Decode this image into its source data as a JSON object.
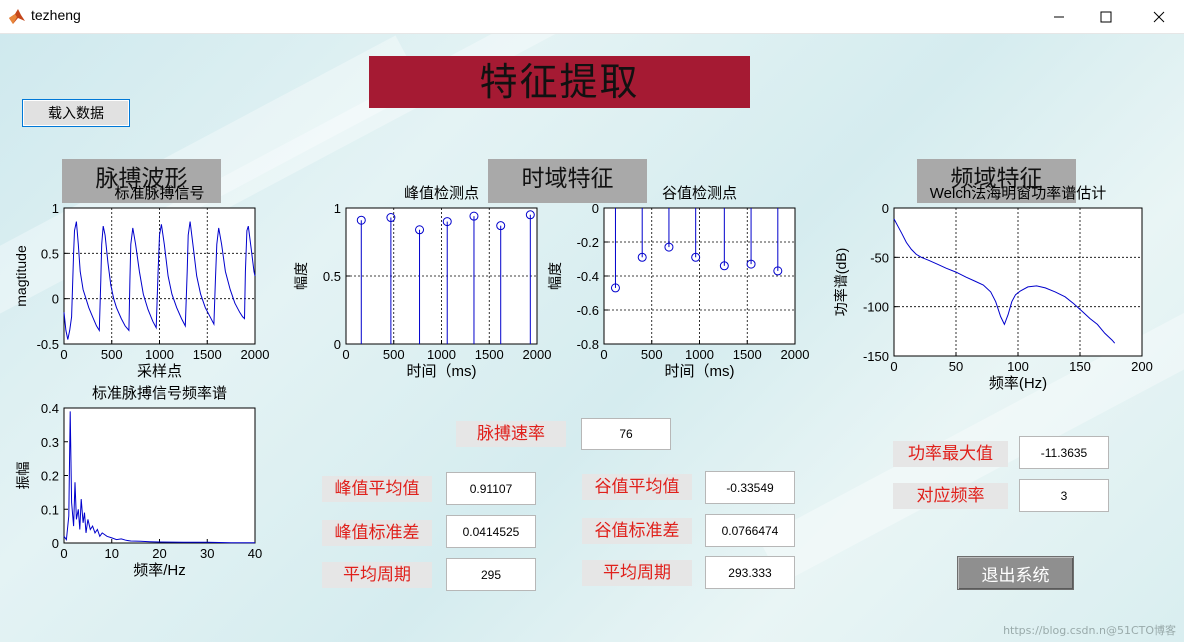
{
  "window": {
    "title": "tezheng",
    "minimize_glyph": "—",
    "maximize_glyph": "☐",
    "close_glyph": "✕",
    "app_icon": "matlab-icon"
  },
  "main_title": "特征提取",
  "load_button": "载入数据",
  "sections": {
    "pulse": "脉搏波形",
    "time": "时域特征",
    "freq": "频域特征"
  },
  "labels": {
    "pulse_rate": "脉搏速率",
    "peak_mean": "峰值平均值",
    "peak_std": "峰值标准差",
    "peak_period": "平均周期",
    "valley_mean": "谷值平均值",
    "valley_std": "谷值标准差",
    "valley_period": "平均周期",
    "power_max": "功率最大值",
    "corr_freq": "对应频率"
  },
  "values": {
    "pulse_rate": "76",
    "peak_mean": "0.91107",
    "peak_std": "0.0414525",
    "peak_period": "295",
    "valley_mean": "-0.33549",
    "valley_std": "0.0766474",
    "valley_period": "293.333",
    "power_max": "-11.3635",
    "corr_freq": "3"
  },
  "exit_button": "退出系统",
  "watermark": "https://blog.csdn.n@51CTO博客",
  "colors": {
    "title_bg": "#a51a33",
    "line": "#0000cc",
    "label_red": "#e0201b"
  },
  "chart_data": [
    {
      "id": "pulse_signal",
      "type": "line",
      "title": "标准脉搏信号",
      "xlabel": "采样点",
      "ylabel": "magtitude",
      "xlim": [
        0,
        2000
      ],
      "ylim": [
        -0.5,
        1
      ],
      "xticks": [
        "0",
        "500",
        "1000",
        "1500",
        "2000"
      ],
      "yticks": [
        "-0.5",
        "0",
        "0.5",
        "1"
      ],
      "grid": true,
      "x": [
        0,
        20,
        40,
        60,
        80,
        100,
        110,
        130,
        150,
        170,
        200,
        230,
        260,
        300,
        340,
        370,
        385,
        395,
        410,
        430,
        460,
        490,
        520,
        550,
        600,
        640,
        680,
        690,
        700,
        720,
        750,
        790,
        830,
        880,
        930,
        965,
        985,
        1000,
        1020,
        1050,
        1090,
        1130,
        1180,
        1230,
        1270,
        1290,
        1300,
        1320,
        1350,
        1390,
        1430,
        1480,
        1530,
        1570,
        1585,
        1600,
        1620,
        1650,
        1690,
        1740,
        1790,
        1840,
        1870,
        1890,
        1900,
        1915,
        1930,
        1960,
        1990,
        2000
      ],
      "y": [
        -0.15,
        -0.35,
        -0.45,
        -0.35,
        -0.2,
        0.5,
        0.75,
        0.85,
        0.6,
        0.3,
        0.1,
        0.0,
        -0.1,
        -0.2,
        -0.3,
        -0.35,
        0.2,
        0.6,
        0.8,
        0.7,
        0.4,
        0.15,
        0.0,
        -0.1,
        -0.22,
        -0.3,
        -0.35,
        0.2,
        0.6,
        0.78,
        0.6,
        0.3,
        0.05,
        -0.12,
        -0.25,
        -0.32,
        0.3,
        0.7,
        0.82,
        0.6,
        0.25,
        0.05,
        -0.1,
        -0.22,
        -0.3,
        0.3,
        0.7,
        0.85,
        0.6,
        0.25,
        0.05,
        -0.1,
        -0.2,
        -0.28,
        0.2,
        0.6,
        0.78,
        0.6,
        0.3,
        0.1,
        -0.05,
        -0.15,
        -0.2,
        -0.22,
        0.3,
        0.75,
        0.8,
        0.55,
        0.3,
        0.25
      ]
    },
    {
      "id": "pulse_spectrum",
      "type": "line",
      "title": "标准脉搏信号频率谱",
      "xlabel": "频率/Hz",
      "ylabel": "振幅",
      "xlim": [
        0,
        40
      ],
      "ylim": [
        0,
        0.4
      ],
      "xticks": [
        "0",
        "10",
        "20",
        "30",
        "40"
      ],
      "yticks": [
        "0",
        "0.1",
        "0.2",
        "0.3",
        "0.4"
      ],
      "grid": false,
      "x": [
        0,
        0.5,
        1,
        1.3,
        1.6,
        2,
        2.3,
        2.6,
        3,
        3.3,
        3.6,
        4,
        4.3,
        4.6,
        5,
        5.5,
        6,
        6.5,
        7,
        7.5,
        8,
        9,
        10,
        11,
        12,
        13,
        14,
        16,
        18,
        20,
        25,
        30,
        35,
        40
      ],
      "y": [
        0.02,
        0.01,
        0.08,
        0.39,
        0.12,
        0.05,
        0.18,
        0.07,
        0.1,
        0.04,
        0.13,
        0.06,
        0.09,
        0.03,
        0.07,
        0.04,
        0.05,
        0.03,
        0.04,
        0.02,
        0.03,
        0.02,
        0.015,
        0.01,
        0.012,
        0.008,
        0.006,
        0.005,
        0.004,
        0.003,
        0.002,
        0.002,
        0.001,
        0.001
      ]
    },
    {
      "id": "peak_points",
      "type": "stem",
      "title": "峰值检测点",
      "xlabel": "时间（ms)",
      "ylabel": "幅度",
      "xlim": [
        0,
        2000
      ],
      "ylim": [
        0,
        1
      ],
      "xticks": [
        "0",
        "500",
        "1000",
        "1500",
        "2000"
      ],
      "yticks": [
        "0",
        "0.5",
        "1"
      ],
      "grid": true,
      "x": [
        160,
        470,
        770,
        1060,
        1340,
        1620,
        1930
      ],
      "y": [
        0.91,
        0.93,
        0.84,
        0.9,
        0.94,
        0.87,
        0.95
      ]
    },
    {
      "id": "valley_points",
      "type": "stem",
      "title": "谷值检测点",
      "xlabel": "时间（ms)",
      "ylabel": "幅度",
      "xlim": [
        0,
        2000
      ],
      "ylim": [
        -0.8,
        0
      ],
      "xticks": [
        "0",
        "500",
        "1000",
        "1500",
        "2000"
      ],
      "yticks": [
        "0",
        "-0.2",
        "-0.4",
        "-0.6",
        "-0.8"
      ],
      "grid": true,
      "x": [
        120,
        400,
        680,
        960,
        1260,
        1540,
        1820
      ],
      "y": [
        -0.47,
        -0.29,
        -0.23,
        -0.29,
        -0.34,
        -0.33,
        -0.37
      ]
    },
    {
      "id": "welch_psd",
      "type": "line",
      "title": "Welch法海明窗功率谱估计",
      "xlabel": "频率(Hz)",
      "ylabel": "功率谱(dB)",
      "xlim": [
        0,
        200
      ],
      "ylim": [
        -150,
        0
      ],
      "xticks": [
        "0",
        "50",
        "100",
        "150",
        "200"
      ],
      "yticks": [
        "0",
        "-50",
        "-100",
        "-150"
      ],
      "grid": true,
      "x": [
        0,
        3,
        6,
        10,
        14,
        18,
        22,
        28,
        35,
        42,
        50,
        58,
        65,
        72,
        78,
        82,
        86,
        89,
        92,
        95,
        98,
        102,
        108,
        115,
        122,
        130,
        138,
        145,
        152,
        158,
        164,
        170,
        176,
        178
      ],
      "y": [
        -11,
        -18,
        -25,
        -35,
        -42,
        -47,
        -50,
        -53,
        -57,
        -61,
        -65,
        -70,
        -74,
        -78,
        -85,
        -95,
        -110,
        -118,
        -108,
        -95,
        -88,
        -84,
        -80,
        -79,
        -81,
        -85,
        -90,
        -97,
        -105,
        -112,
        -118,
        -127,
        -134,
        -137
      ]
    }
  ]
}
